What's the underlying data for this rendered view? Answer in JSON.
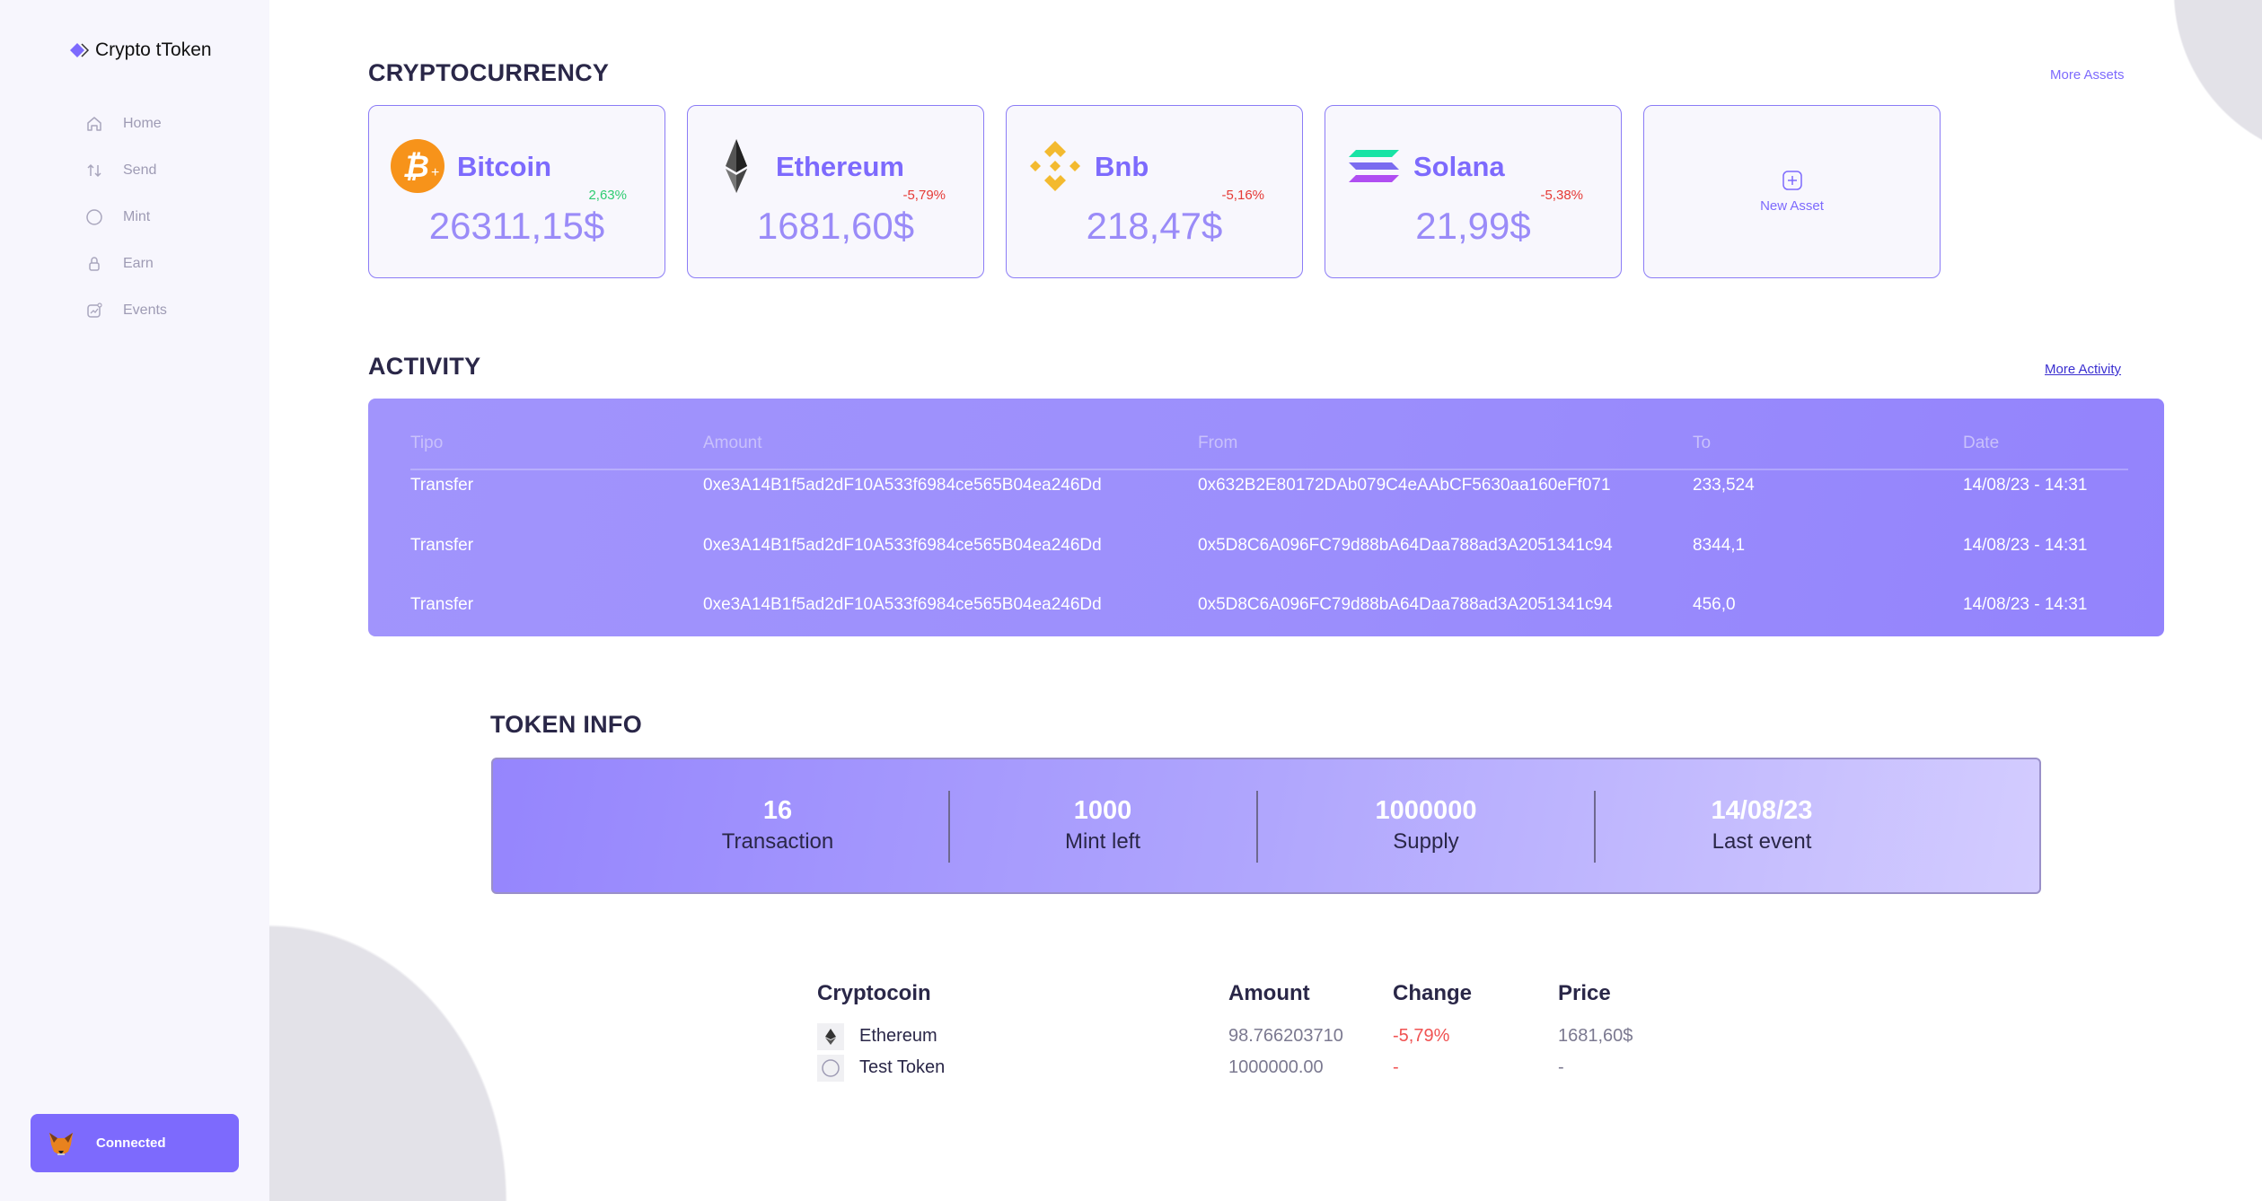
{
  "sidebar": {
    "brand": "Crypto tToken",
    "items": [
      {
        "label": "Home",
        "icon": "home-icon"
      },
      {
        "label": "Send",
        "icon": "transfer-arrows-icon"
      },
      {
        "label": "Mint",
        "icon": "circle-icon"
      },
      {
        "label": "Earn",
        "icon": "lock-icon"
      },
      {
        "label": "Events",
        "icon": "chart-icon"
      }
    ],
    "wallet_label": "Connected"
  },
  "crypto": {
    "title": "CRYPTOCURRENCY",
    "more": "More Assets",
    "cards": [
      {
        "name": "Bitcoin",
        "change": "2,63%",
        "price": "26311,15$"
      },
      {
        "name": "Ethereum",
        "change": "-5,79%",
        "price": "1681,60$"
      },
      {
        "name": "Bnb",
        "change": "-5,16%",
        "price": "218,47$"
      },
      {
        "name": "Solana",
        "change": "-5,38%",
        "price": "21,99$"
      }
    ],
    "new_asset": "New Asset"
  },
  "activity": {
    "title": "ACTIVITY",
    "more": "More Activity",
    "columns": [
      "Tipo",
      "Amount",
      "From",
      "To",
      "Date"
    ],
    "rows": [
      [
        "Transfer",
        "0xe3A14B1f5ad2dF10A533f6984ce565B04ea246Dd",
        "0x632B2E80172DAb079C4eAAbCF5630aa160eFf071",
        "233,524",
        "14/08/23 - 14:31"
      ],
      [
        "Transfer",
        "0xe3A14B1f5ad2dF10A533f6984ce565B04ea246Dd",
        "0x5D8C6A096FC79d88bA64Daa788ad3A2051341c94",
        "8344,1",
        "14/08/23 - 14:31"
      ],
      [
        "Transfer",
        "0xe3A14B1f5ad2dF10A533f6984ce565B04ea246Dd",
        "0x5D8C6A096FC79d88bA64Daa788ad3A2051341c94",
        "456,0",
        "14/08/23 - 14:31"
      ]
    ]
  },
  "token_info": {
    "title": "TOKEN INFO",
    "stats": [
      {
        "value": "16",
        "label": "Transaction"
      },
      {
        "value": "1000",
        "label": "Mint left"
      },
      {
        "value": "1000000",
        "label": "Supply"
      },
      {
        "value": "14/08/23",
        "label": "Last event"
      }
    ]
  },
  "holdings": {
    "columns": [
      "Cryptocoin",
      "Amount",
      "Change",
      "Price"
    ],
    "rows": [
      {
        "coin": "Ethereum",
        "amount": "98.766203710",
        "change": "-5,79%",
        "price": "1681,60$"
      },
      {
        "coin": "Test Token",
        "amount": "1000000.00",
        "change": "-",
        "price": "-"
      }
    ]
  },
  "colors": {
    "accent": "#7d6afd",
    "positive": "#2ecc71",
    "negative": "#e53935"
  }
}
